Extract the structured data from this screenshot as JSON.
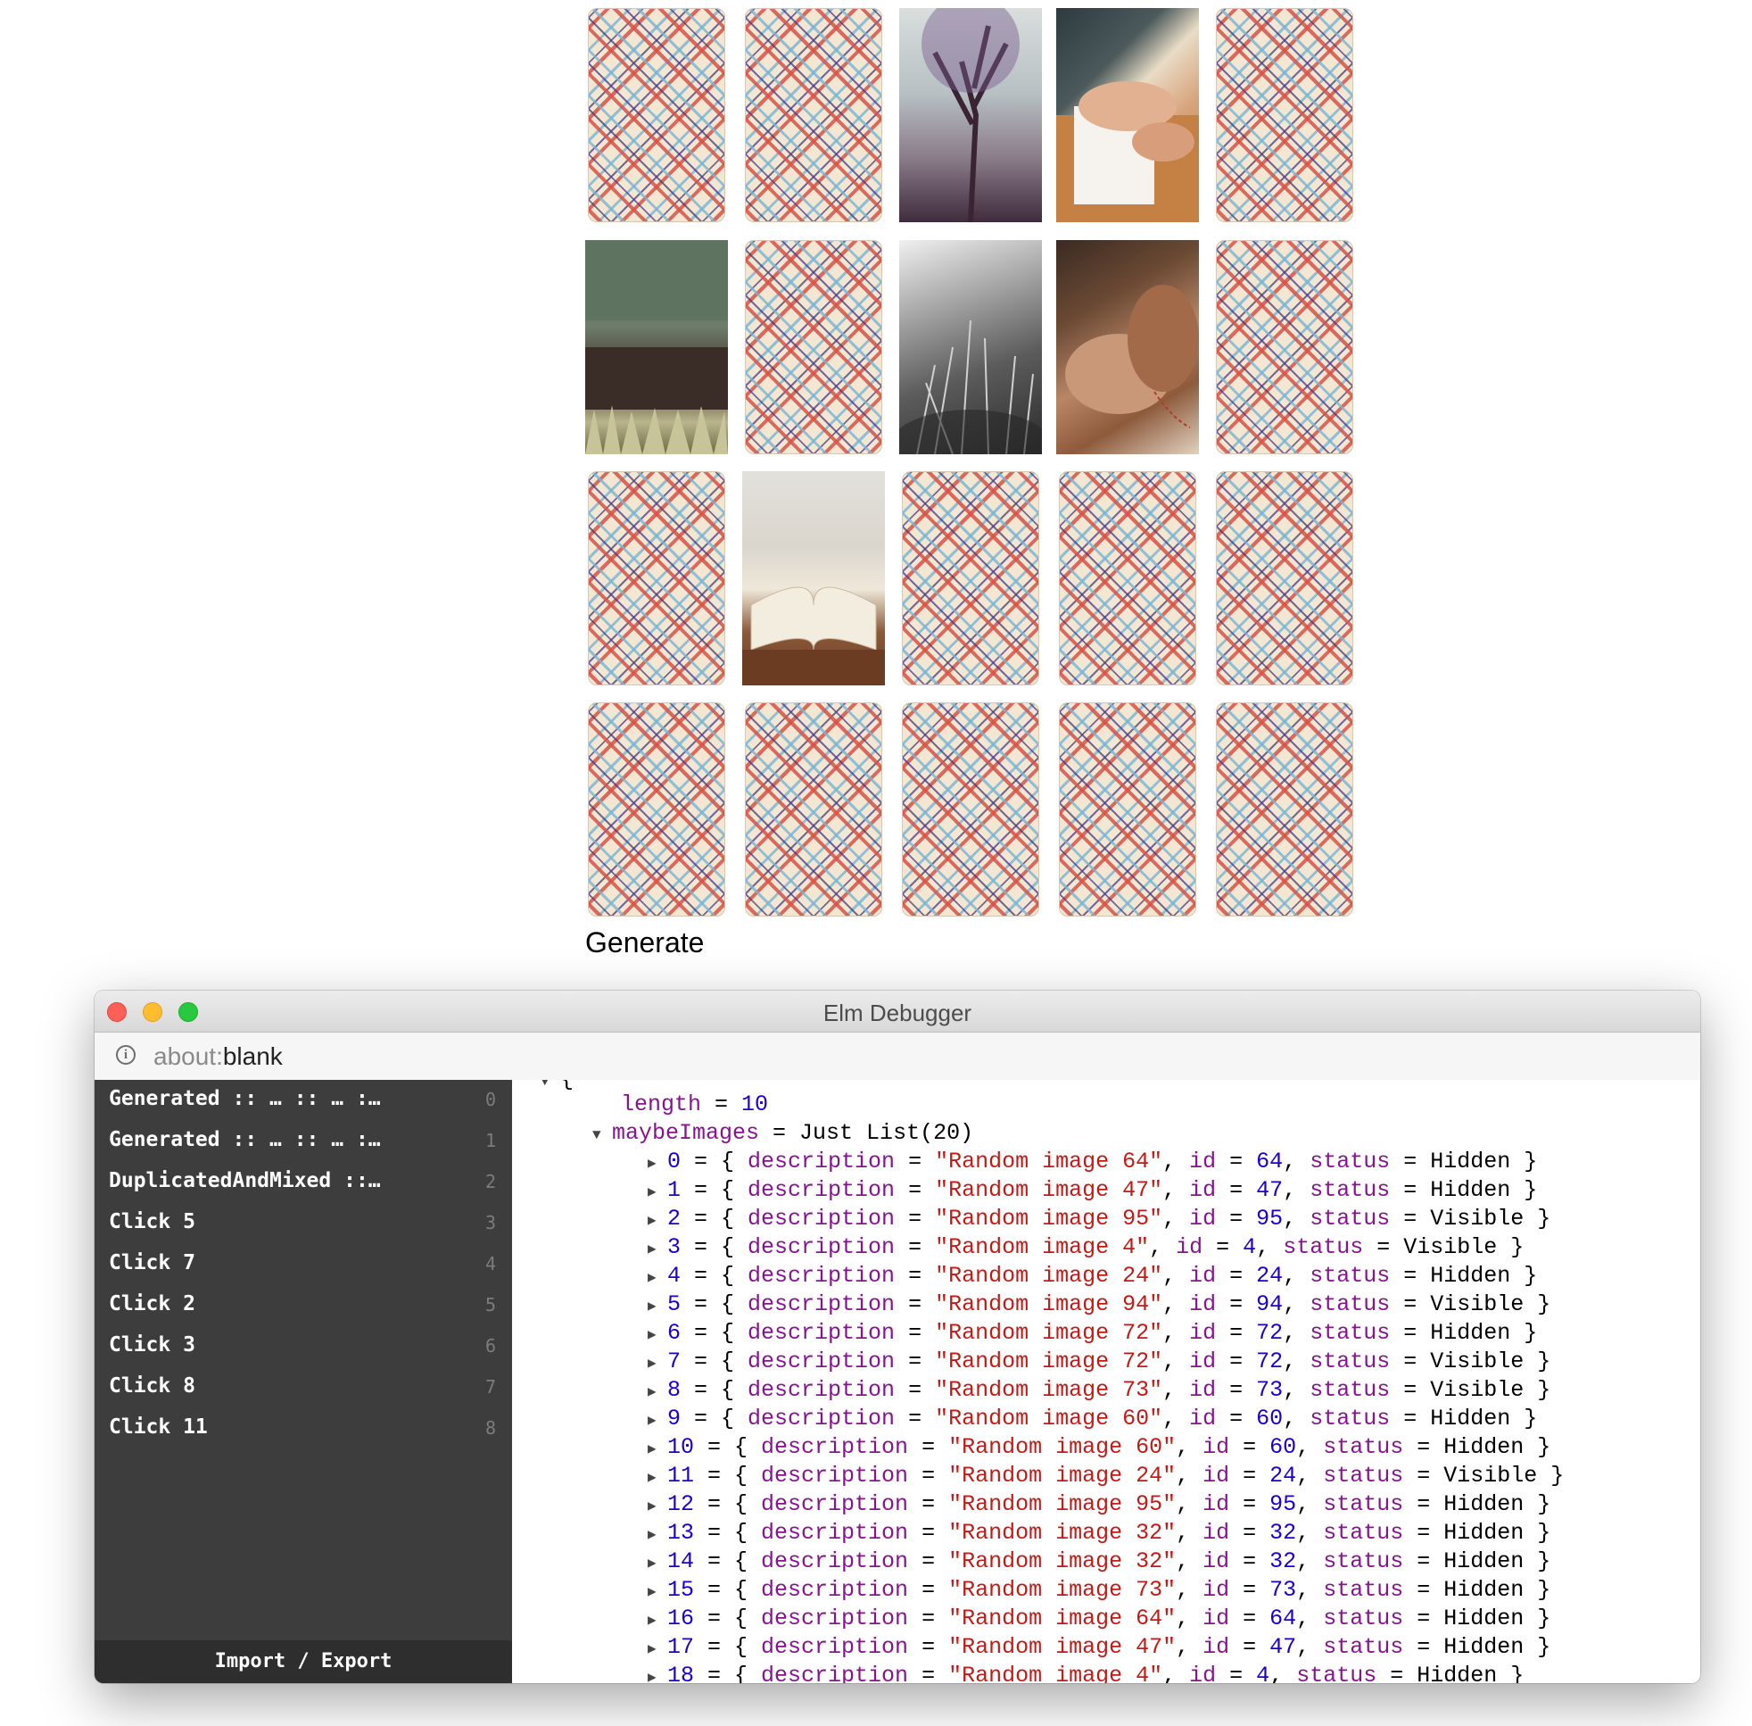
{
  "game": {
    "cards": [
      {
        "state": "hidden"
      },
      {
        "state": "hidden"
      },
      {
        "state": "visible",
        "photo": "tree"
      },
      {
        "state": "visible",
        "photo": "hand"
      },
      {
        "state": "hidden"
      },
      {
        "state": "visible",
        "photo": "grass"
      },
      {
        "state": "hidden"
      },
      {
        "state": "visible",
        "photo": "weeds"
      },
      {
        "state": "visible",
        "photo": "glove"
      },
      {
        "state": "hidden"
      },
      {
        "state": "hidden"
      },
      {
        "state": "visible",
        "photo": "book"
      },
      {
        "state": "hidden"
      },
      {
        "state": "hidden"
      },
      {
        "state": "hidden"
      },
      {
        "state": "hidden"
      },
      {
        "state": "hidden"
      },
      {
        "state": "hidden"
      },
      {
        "state": "hidden"
      },
      {
        "state": "hidden"
      }
    ],
    "generate_label": "Generate"
  },
  "debugger": {
    "window_title": "Elm Debugger",
    "url_scheme": "about:",
    "url_host": "blank",
    "messages": [
      {
        "text": "Generated :: … :: … :…",
        "index": "0"
      },
      {
        "text": "Generated :: … :: … :…",
        "index": "1"
      },
      {
        "text": "DuplicatedAndMixed ::…",
        "index": "2"
      },
      {
        "text": "Click 5",
        "index": "3"
      },
      {
        "text": "Click 7",
        "index": "4"
      },
      {
        "text": "Click 2",
        "index": "5"
      },
      {
        "text": "Click 3",
        "index": "6"
      },
      {
        "text": "Click 8",
        "index": "7"
      },
      {
        "text": "Click 11",
        "index": "8"
      }
    ],
    "import_export_label": "Import / Export",
    "model": {
      "open_brace": "{",
      "length_key": "length",
      "length_value": "10",
      "maybe_key": "maybeImages",
      "maybe_value": "Just List(20)",
      "entries": [
        {
          "i": "0",
          "desc": "\"Random image 64\"",
          "id": "64",
          "status": "Hidden"
        },
        {
          "i": "1",
          "desc": "\"Random image 47\"",
          "id": "47",
          "status": "Hidden"
        },
        {
          "i": "2",
          "desc": "\"Random image 95\"",
          "id": "95",
          "status": "Visible"
        },
        {
          "i": "3",
          "desc": "\"Random image 4\"",
          "id": "4",
          "status": "Visible"
        },
        {
          "i": "4",
          "desc": "\"Random image 24\"",
          "id": "24",
          "status": "Hidden"
        },
        {
          "i": "5",
          "desc": "\"Random image 94\"",
          "id": "94",
          "status": "Visible"
        },
        {
          "i": "6",
          "desc": "\"Random image 72\"",
          "id": "72",
          "status": "Hidden"
        },
        {
          "i": "7",
          "desc": "\"Random image 72\"",
          "id": "72",
          "status": "Visible"
        },
        {
          "i": "8",
          "desc": "\"Random image 73\"",
          "id": "73",
          "status": "Visible"
        },
        {
          "i": "9",
          "desc": "\"Random image 60\"",
          "id": "60",
          "status": "Hidden"
        },
        {
          "i": "10",
          "desc": "\"Random image 60\"",
          "id": "60",
          "status": "Hidden"
        },
        {
          "i": "11",
          "desc": "\"Random image 24\"",
          "id": "24",
          "status": "Visible"
        },
        {
          "i": "12",
          "desc": "\"Random image 95\"",
          "id": "95",
          "status": "Hidden"
        },
        {
          "i": "13",
          "desc": "\"Random image 32\"",
          "id": "32",
          "status": "Hidden"
        },
        {
          "i": "14",
          "desc": "\"Random image 32\"",
          "id": "32",
          "status": "Hidden"
        },
        {
          "i": "15",
          "desc": "\"Random image 73\"",
          "id": "73",
          "status": "Hidden"
        },
        {
          "i": "16",
          "desc": "\"Random image 64\"",
          "id": "64",
          "status": "Hidden"
        },
        {
          "i": "17",
          "desc": "\"Random image 47\"",
          "id": "47",
          "status": "Hidden"
        },
        {
          "i": "18",
          "desc": "\"Random image 4\"",
          "id": "4",
          "status": "Hidden"
        }
      ]
    }
  }
}
